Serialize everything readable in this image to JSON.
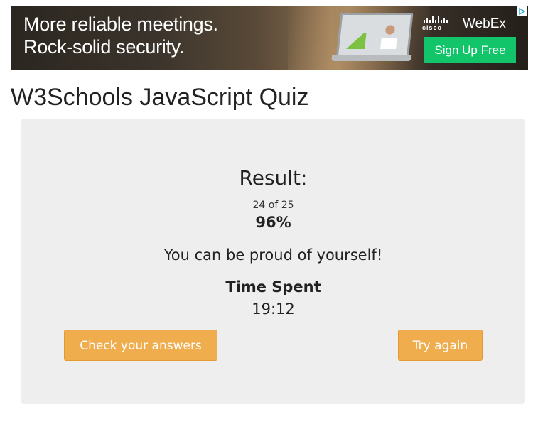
{
  "ad": {
    "headline": "More reliable meetings.\nRock-solid security.",
    "brand_cisco": "cisco",
    "brand_product": "WebEx",
    "cta_label": "Sign Up Free",
    "cta_color": "#12c56b",
    "choices_icon": "adchoices-icon"
  },
  "page": {
    "title": "W3Schools JavaScript Quiz"
  },
  "result": {
    "heading": "Result:",
    "score_fraction": "24 of 25",
    "score_percent": "96%",
    "feedback": "You can be proud of yourself!",
    "time_label": "Time Spent",
    "time_value": "19:12"
  },
  "actions": {
    "check_answers_label": "Check your answers",
    "try_again_label": "Try again",
    "button_color": "#f0ad4e"
  },
  "colors": {
    "panel_background": "#eeeeee",
    "text": "#222222"
  }
}
